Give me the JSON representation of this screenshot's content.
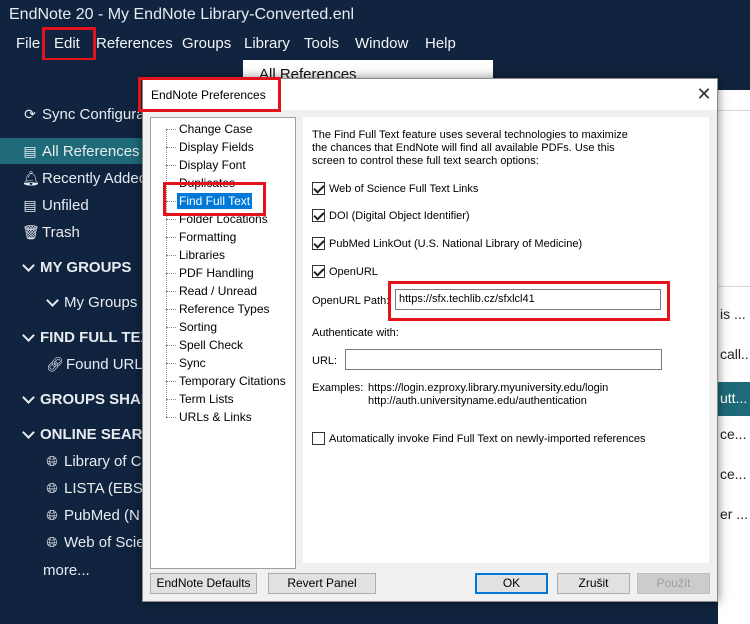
{
  "window": {
    "title": "EndNote 20 - My EndNote Library-Converted.enl"
  },
  "menu": [
    "File",
    "Edit",
    "References",
    "Groups",
    "Library",
    "Tools",
    "Window",
    "Help"
  ],
  "sidebar": {
    "sync": "Sync Configura",
    "all_refs": "All References",
    "recent": "Recently Addec",
    "unfiled": "Unfiled",
    "trash": "Trash",
    "my_groups_header": "MY GROUPS",
    "my_groups": "My Groups",
    "fft_header": "FIND FULL TEX",
    "found_url": "Found URL",
    "groups_shared_header": "GROUPS SHAI",
    "online_header": "ONLINE SEAR",
    "online": [
      "Library of C",
      "LISTA (EBSC",
      "PubMed (N",
      "Web of Scie"
    ],
    "more": "more..."
  },
  "doc_header": "All References",
  "right_list_snippets": [
    "is ...",
    "call...",
    "utt...",
    "ce...",
    "ce...",
    "er ..."
  ],
  "dialog": {
    "title": "EndNote Preferences",
    "tree_items": [
      "Change Case",
      "Display Fields",
      "Display Font",
      "Duplicates",
      "Find Full Text",
      "Folder Locations",
      "Formatting",
      "Libraries",
      "PDF Handling",
      "Read / Unread",
      "Reference Types",
      "Sorting",
      "Spell Check",
      "Sync",
      "Temporary Citations",
      "Term Lists",
      "URLs & Links"
    ],
    "selected_item": "Find Full Text",
    "description": "The Find Full Text feature uses several technologies to maximize the chances that EndNote will find all available PDFs. Use this screen to control these full text search options:",
    "options": [
      {
        "label": "Web of Science Full Text Links",
        "checked": true
      },
      {
        "label": "DOI (Digital Object Identifier)",
        "checked": true
      },
      {
        "label": "PubMed LinkOut (U.S. National Library of Medicine)",
        "checked": true
      },
      {
        "label": "OpenURL",
        "checked": true
      }
    ],
    "openurl_path_label": "OpenURL Path:",
    "openurl_path_value": "https://sfx.techlib.cz/sfxlcl41",
    "authenticate_label": "Authenticate with:",
    "url_label": "URL:",
    "url_value": "",
    "examples_label": "Examples:",
    "examples": [
      "https://login.ezproxy.library.myuniversity.edu/login",
      "http://auth.universityname.edu/authentication"
    ],
    "auto_invoke": {
      "label": "Automatically invoke Find Full Text on newly-imported references",
      "checked": false
    },
    "buttons": {
      "defaults": "EndNote Defaults",
      "revert": "Revert Panel",
      "ok": "OK",
      "cancel": "Zrušit",
      "apply": "Použít"
    },
    "close_glyph": "✕"
  },
  "colors": {
    "app_bg": "#10243f",
    "selection_teal": "#1e6a78",
    "highlight_red": "#e3121b",
    "tree_selected": "#0078d7"
  }
}
